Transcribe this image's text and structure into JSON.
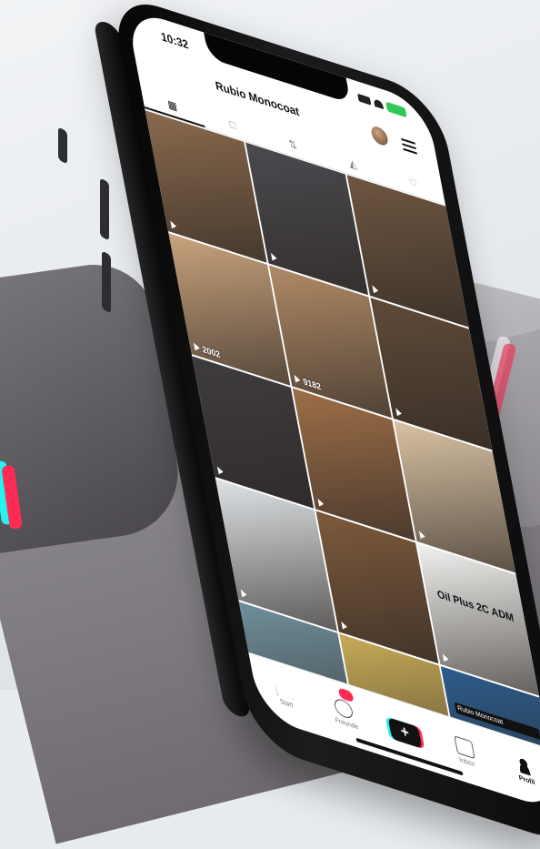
{
  "status_bar": {
    "time": "10:32"
  },
  "profile_header": {
    "username": "Rubio Monocoat"
  },
  "profile_tabs": [
    "videos-grid",
    "private",
    "reposts",
    "favorites",
    "liked"
  ],
  "videos": [
    {
      "views": "",
      "caption": "",
      "bg": "#8a6a4d"
    },
    {
      "views": "",
      "caption": "",
      "bg": "#4b4a4f"
    },
    {
      "views": "",
      "caption": "",
      "bg": "#6e5640"
    },
    {
      "views": "2002",
      "caption": "",
      "bg": "#c9a37c"
    },
    {
      "views": "9182",
      "caption": "",
      "bg": "#b08a66"
    },
    {
      "views": "",
      "caption": "",
      "bg": "#5f4a38"
    },
    {
      "views": "",
      "caption": "",
      "bg": "#3f3c40"
    },
    {
      "views": "",
      "caption": "",
      "bg": "#9e6f48"
    },
    {
      "views": "",
      "caption": "",
      "bg": "#d9c2a3"
    },
    {
      "views": "",
      "caption": "",
      "bg": "#dfe3e6"
    },
    {
      "views": "",
      "caption": "",
      "bg": "#7d5a3c"
    },
    {
      "views": "",
      "caption": "Oil Plus 2C ADM",
      "bg": "#f2f2f0"
    },
    {
      "views": "",
      "caption": "",
      "bg": "#6f8f9b"
    },
    {
      "views": "",
      "caption": "",
      "bg": "#c7ab58"
    },
    {
      "views": "",
      "caption": "Rubio Monocoat",
      "bg": "#2c5b8a"
    }
  ],
  "bottom_nav": {
    "home": "Start",
    "friends": "Freunde",
    "friends_badge": "",
    "inbox": "Inbox",
    "profile": "Profil"
  },
  "colors": {
    "accent_cyan": "#25f4ee",
    "accent_pink": "#fe2c55",
    "battery": "#33c759"
  }
}
